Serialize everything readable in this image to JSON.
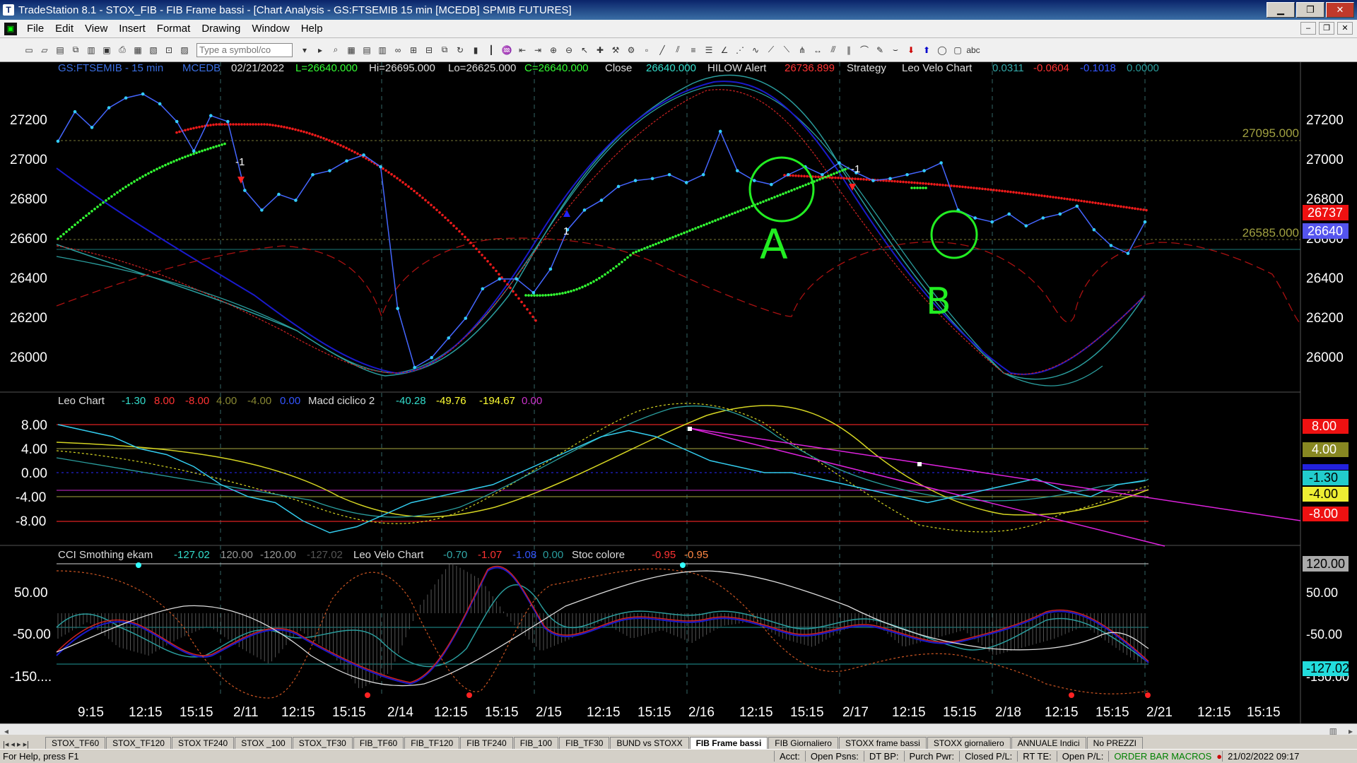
{
  "window": {
    "title": "TradeStation 8.1 - STOX_FIB - FIB Frame bassi - [Chart Analysis - GS:FTSEMIB  15 min  [MCEDB] SPMIB FUTURES]",
    "minimize": "▁",
    "restore": "❐",
    "close": "✕"
  },
  "menu": {
    "items": [
      "File",
      "Edit",
      "View",
      "Insert",
      "Format",
      "Drawing",
      "Window",
      "Help"
    ]
  },
  "toolbar": {
    "symbol_placeholder": "Type a symbol/co"
  },
  "header": {
    "symbol": "GS:FTSEMIB - 15 min",
    "feed": "MCEDB",
    "date": "02/21/2022",
    "last": "L=26640.000",
    "hi": "Hi=26695.000",
    "lo": "Lo=26625.000",
    "close_val": "C=26640.000",
    "close_label": "Close",
    "close_num": "26640.000",
    "hilow": "HILOW Alert",
    "hilow_val": "26736.899",
    "strategy": "Strategy",
    "leovelo": "Leo Velo Chart",
    "lv1": "0.0311",
    "lv2": "-0.0604",
    "lv3": "-0.1018",
    "lv4": "0.0000"
  },
  "pane2_header": {
    "name": "Leo Chart",
    "v1": "-1.30",
    "v2": "8.00",
    "v3": "-8.00",
    "v4": "4.00",
    "v5": "-4.00",
    "v6": "0.00",
    "macd": "Macd ciclico 2",
    "m1": "-40.28",
    "m2": "-49.76",
    "m3": "-194.67",
    "m4": "0.00"
  },
  "pane3_header": {
    "name": "CCI Smothing ekam",
    "v1": "-127.02",
    "v2": "120.00",
    "v3": "-120.00",
    "v4": "-127.02",
    "leovelo": "Leo Velo Chart",
    "l1": "-0.70",
    "l2": "-1.07",
    "l3": "-1.08",
    "l4": "0.00",
    "stoc": "Stoc colore",
    "s1": "-0.95",
    "s2": "-0.95"
  },
  "axis1": {
    "ticks": [
      "27200",
      "27000",
      "26800",
      "26600",
      "26400",
      "26200",
      "26000"
    ]
  },
  "axis2": {
    "ticks": [
      "8.00",
      "4.00",
      "0.00",
      "-4.00",
      "-8.00"
    ]
  },
  "axis3": {
    "ticks": [
      "50.00",
      "-50.00",
      "-150...."
    ]
  },
  "right_axis1": {
    "ticks": [
      "27200",
      "27000",
      "26800",
      "26400",
      "26200",
      "26000"
    ],
    "hilow_badge": "26737",
    "last_badge": "26640",
    "hidden_tick": "26600"
  },
  "right_axis2": {
    "b1": "8.00",
    "b2": "4.00",
    "b3": "-1.30",
    "b4": "-4.00",
    "b5": "-8.00"
  },
  "right_axis3": {
    "b1": "120.00",
    "t1": "50.00",
    "t2": "-50.00",
    "b2": "-127.02",
    "t3": "-150.00"
  },
  "levels": {
    "l1": "27095.000",
    "l2": "26585.000"
  },
  "time_axis": [
    "9:15",
    "12:15",
    "15:15",
    "2/11",
    "12:15",
    "15:15",
    "2/14",
    "12:15",
    "15:15",
    "2/15",
    "12:15",
    "15:15",
    "2/16",
    "12:15",
    "15:15",
    "2/17",
    "12:15",
    "15:15",
    "2/18",
    "12:15",
    "15:15",
    "2/21",
    "12:15",
    "15:15"
  ],
  "annotations": {
    "a": "A",
    "b": "B",
    "m1a": "-1",
    "m1b": "-1",
    "p1": "1"
  },
  "tabs": [
    "STOX_TF60",
    "STOX_TF120",
    "STOX TF240",
    "STOX _100",
    "STOX_TF30",
    "FIB_TF60",
    "FIB_TF120",
    "FIB TF240",
    "FIB_100",
    "FIB_TF30",
    "BUND vs STOXX",
    "FIB Frame bassi",
    "FIB Giornaliero",
    "STOXX frame bassi",
    "STOXX giornaliero",
    "ANNUALE Indici",
    "No PREZZI"
  ],
  "active_tab": "FIB Frame bassi",
  "status": {
    "help": "For Help, press F1",
    "acct": "Acct:",
    "open_psns": "Open Psns:",
    "dtbp": "DT BP:",
    "purch": "Purch Pwr:",
    "closed_pl": "Closed P/L:",
    "rtte": "RT TE:",
    "open_pl": "Open P/L:",
    "macros": "ORDER BAR  MACROS",
    "datetime": "21/02/2022 09:17"
  },
  "colors": {
    "background": "#000000",
    "price": "#33ccff",
    "hilow": "#ff1a1a",
    "strategy": "#33ff33",
    "blue": "#1a1aff",
    "teal": "#2a9d9d"
  },
  "chart_data": [
    {
      "type": "line",
      "title": "GS:FTSEMIB - 15 min",
      "ylim": [
        25800,
        27380
      ],
      "series": [
        {
          "name": "Close",
          "values": [
            27050,
            27200,
            27120,
            27220,
            27270,
            27290,
            27240,
            27150,
            27000,
            27180,
            27150,
            26800,
            26700,
            26780,
            26750,
            26880,
            26900,
            26950,
            26980,
            26920,
            26200,
            25900,
            25950,
            26050,
            26150,
            26300,
            26350,
            26350,
            26280,
            26400,
            26600,
            26700,
            26750,
            26820,
            26850,
            26860,
            26880,
            26840,
            26880,
            27100,
            26900,
            26850,
            26830,
            26880,
            26920,
            26880,
            26940,
            26890,
            26850,
            26860,
            26880,
            26900,
            26940,
            26700,
            26660,
            26640,
            26680,
            26620,
            26660,
            26680,
            26720,
            26600,
            26520,
            26480,
            26640
          ]
        }
      ],
      "levels": [
        27095,
        26585
      ]
    },
    {
      "type": "line",
      "title": "Leo Chart",
      "ylim": [
        -10,
        12
      ],
      "series": [
        {
          "name": "Leo Chart",
          "values": [
            8,
            7,
            6,
            4,
            3,
            1,
            -2,
            -4,
            -5,
            -8,
            -10,
            -9,
            -7,
            -5,
            -4,
            -3,
            -2,
            0,
            2,
            4,
            6,
            7,
            6,
            4,
            2,
            1,
            0,
            0,
            -1,
            -2,
            -3,
            -4,
            -5,
            -4,
            -3,
            -2,
            -1,
            -3,
            -4,
            -2,
            -1.3
          ]
        }
      ]
    },
    {
      "type": "line",
      "title": "CCI Smothing ekam",
      "ylim": [
        -200,
        150
      ],
      "series": [
        {
          "name": "CCI Smothing ekam",
          "values": [
            -60,
            -20,
            -80,
            -100,
            -60,
            -30,
            -80,
            -120,
            -40,
            -90,
            -180,
            -140,
            20,
            120,
            80,
            -20,
            -90,
            -60,
            -20,
            -60,
            -40,
            -70,
            -30,
            -20,
            -60,
            -80,
            -40,
            -20,
            -80,
            -60,
            -40,
            -100,
            -80,
            -60,
            -30,
            -80,
            -127
          ]
        }
      ]
    }
  ]
}
